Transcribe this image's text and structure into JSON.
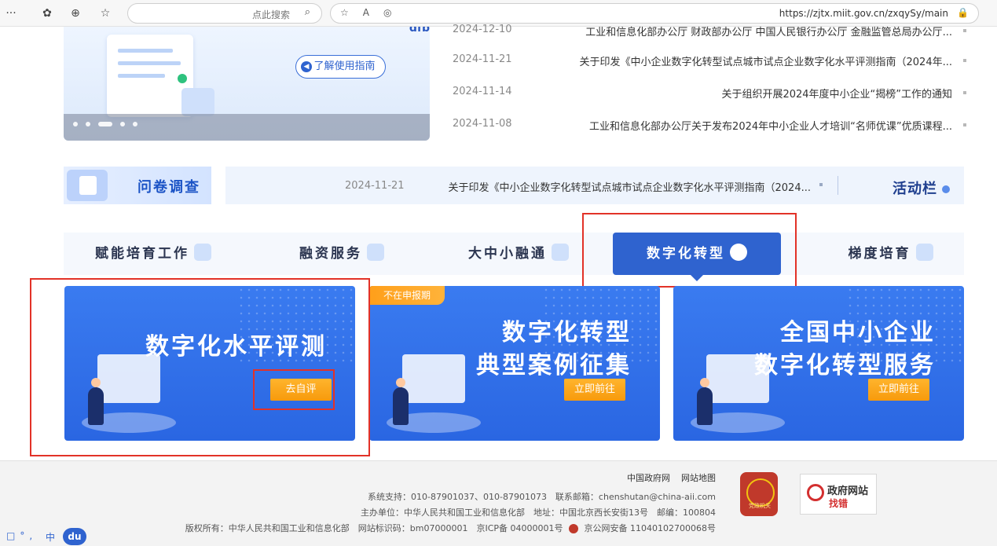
{
  "browser": {
    "url": "https://zjtx.miit.gov.cn/zxqySy/main",
    "search_placeholder": "点此搜索",
    "more_label": "···"
  },
  "banner": {
    "guide_button": "了解使用指南",
    "top_text": "dfb"
  },
  "news": [
    {
      "title": "工业和信息化部办公厅 财政部办公厅 中国人民银行办公厅 金融监管总局办公厅...",
      "date": "2024-12-10"
    },
    {
      "title": "关于印发《中小企业数字化转型试点城市试点企业数字化水平评测指南（2024年...",
      "date": "2024-11-21"
    },
    {
      "title": "关于组织开展2024年度中小企业“揭榜”工作的通知",
      "date": "2024-11-14"
    },
    {
      "title": "工业和信息化部办公厅关于发布2024年中小企业人才培训“名师优课”优质课程...",
      "date": "2024-11-08"
    }
  ],
  "activity": {
    "label": "活动栏",
    "item_title": "关于印发《中小企业数字化转型试点城市试点企业数字化水平评测指南（2024...",
    "item_date": "2024-11-21",
    "survey_label": "问卷调查"
  },
  "tabs": [
    {
      "label": "梯度培育",
      "active": false
    },
    {
      "label": "数字化转型",
      "active": true
    },
    {
      "label": "大中小融通",
      "active": false
    },
    {
      "label": "融资服务",
      "active": false
    },
    {
      "label": "赋能培育工作",
      "active": false
    }
  ],
  "cards": [
    {
      "line1": "全国中小企业",
      "line2": "数字化转型服务",
      "cta": "立即前往"
    },
    {
      "line1": "数字化转型",
      "line2": "典型案例征集",
      "cta": "立即前往",
      "badge": "不在申报期"
    },
    {
      "line1": "数字化水平评测",
      "line2": "",
      "cta": "去自评"
    }
  ],
  "footer": {
    "links": [
      "中国政府网",
      "网站地图"
    ],
    "support": "系统支持：010-87901037、010-87901073　联系邮箱：chenshutan@china-aii.com",
    "host": "主办单位：中华人民共和国工业和信息化部　地址：中国北京西长安街13号　邮编：100804",
    "copyright": "版权所有：中华人民共和国工业和信息化部　网站标识码：bm07000001　京ICP备 04000001号",
    "police": "京公网安备 11040102700068号",
    "seal_text": "党政机关",
    "gov_line1": "政府网站",
    "gov_line2": "找错"
  },
  "ime": {
    "logo": "du",
    "mode": "中"
  }
}
